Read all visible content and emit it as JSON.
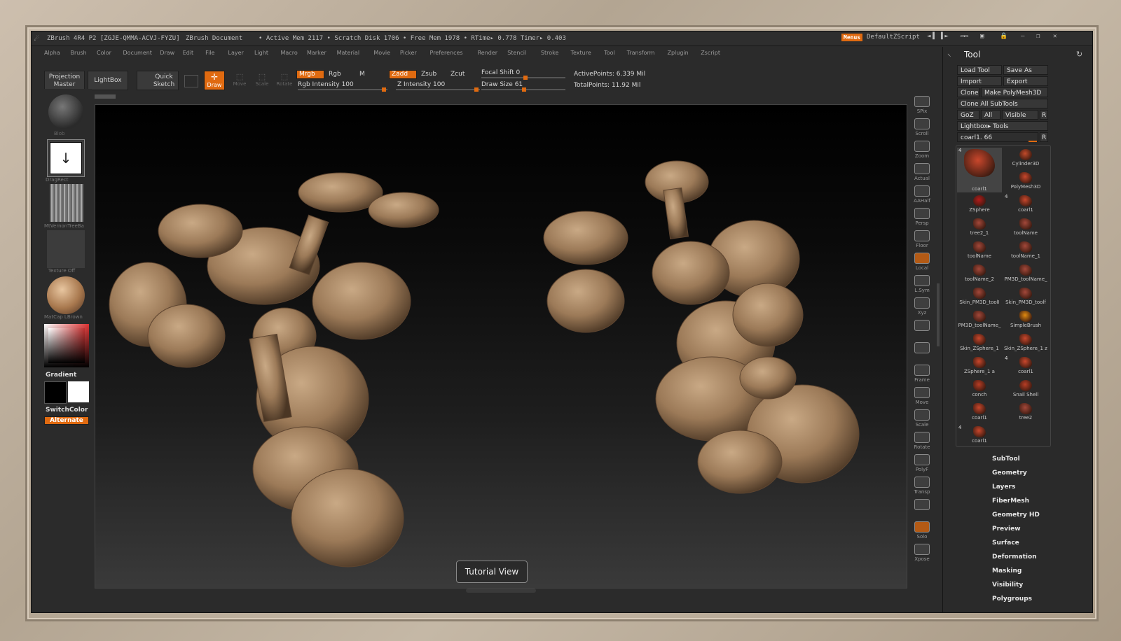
{
  "titlebar": {
    "app": "ZBrush 4R4 P2 [ZGJE-QMMA-ACVJ-FYZU]",
    "document": "ZBrush Document",
    "stats": "• Active Mem 2117 • Scratch Disk 1706 • Free Mem 1978 • RTime▸ 0.778 Timer▸ 0.403",
    "menus_btn": "Menus",
    "script": "DefaultZScript"
  },
  "menu": [
    "Alpha",
    "Brush",
    "Color",
    "Document",
    "Draw",
    "Edit",
    "File",
    "Layer",
    "Light",
    "Macro",
    "Marker",
    "Material",
    "Movie",
    "Picker",
    "Preferences",
    "Render",
    "Stencil",
    "Stroke",
    "Texture",
    "Tool",
    "Transform",
    "Zplugin",
    "Zscript"
  ],
  "toolbar": {
    "projection_master": "Projection Master",
    "lightbox": "LightBox",
    "quick_sketch": "Quick Sketch",
    "edit": "Edit",
    "draw": "Draw",
    "move": "Move",
    "scale": "Scale",
    "rotate": "Rotate",
    "mrgb": "Mrgb",
    "rgb": "Rgb",
    "m": "M",
    "rgb_intensity": "Rgb Intensity 100",
    "zadd": "Zadd",
    "zsub": "Zsub",
    "zcut": "Zcut",
    "z_intensity": "Z Intensity 100",
    "focal_shift": "Focal Shift 0",
    "draw_size": "Draw Size 61",
    "active_points": "ActivePoints: 6.339 Mil",
    "total_points": "TotalPoints: 11.92 Mil"
  },
  "left": {
    "brush_label": "Blob",
    "stroke_label": "DragRect",
    "alpha_label": "MtVernonTreeBa",
    "texture_label": "Texture Off",
    "material_label": "MatCap LBrown",
    "gradient": "Gradient",
    "switch_color": "SwitchColor",
    "alternate": "Alternate"
  },
  "right_shelf": [
    "SPix",
    "Scroll",
    "Zoom",
    "Actual",
    "AAHalf",
    "Persp",
    "Floor",
    "Local",
    "L.Sym",
    "Xyz",
    "",
    "",
    "Frame",
    "Move",
    "Scale",
    "Rotate",
    "PolyF",
    "Transp",
    "",
    "Solo",
    "Xpose"
  ],
  "viewport": {
    "tutorial": "Tutorial View"
  },
  "tray": {
    "title": "Tool",
    "load_tool": "Load Tool",
    "save_as": "Save As",
    "import": "Import",
    "export": "Export",
    "clone": "Clone",
    "make_polymesh": "Make PolyMesh3D",
    "clone_all": "Clone All SubTools",
    "goz": "GoZ",
    "all": "All",
    "visible": "Visible",
    "r": "R",
    "lightbox_tools": "Lightbox▸ Tools",
    "current_tool": "coarl1. 66",
    "tools": [
      {
        "name": "coarl1",
        "badge": "4",
        "color": "#c9472c"
      },
      {
        "name": "Cylinder3D",
        "badge": "",
        "color": "#c24a2a"
      },
      {
        "name": "",
        "badge": "",
        "color": ""
      },
      {
        "name": "PolyMesh3D",
        "badge": "",
        "color": "#c9472c"
      },
      {
        "name": "ZSphere",
        "badge": "",
        "color": "#b31b1b"
      },
      {
        "name": "coarl1",
        "badge": "4",
        "color": "#c9472c"
      },
      {
        "name": "tree2_1",
        "badge": "",
        "color": "#a3483a"
      },
      {
        "name": "toolName",
        "badge": "",
        "color": "#a3483a"
      },
      {
        "name": "toolName",
        "badge": "",
        "color": "#a3483a"
      },
      {
        "name": "toolName_1",
        "badge": "",
        "color": "#a3483a"
      },
      {
        "name": "toolName_2",
        "badge": "",
        "color": "#a3483a"
      },
      {
        "name": "PM3D_toolName_",
        "badge": "",
        "color": "#a3483a"
      },
      {
        "name": "Skin_PM3D_toolI",
        "badge": "",
        "color": "#a3483a"
      },
      {
        "name": "Skin_PM3D_toolf",
        "badge": "",
        "color": "#a3483a"
      },
      {
        "name": "PM3D_toolName_",
        "badge": "",
        "color": "#a3483a"
      },
      {
        "name": "SimpleBrush",
        "badge": "",
        "color": "#e08a10"
      },
      {
        "name": "Skin_ZSphere_1",
        "badge": "",
        "color": "#c9472c"
      },
      {
        "name": "Skin_ZSphere_1 z",
        "badge": "",
        "color": "#c9472c"
      },
      {
        "name": "ZSphere_1 a",
        "badge": "",
        "color": "#c9472c"
      },
      {
        "name": "coarl1",
        "badge": "4",
        "color": "#c9472c"
      },
      {
        "name": "conch",
        "badge": "",
        "color": "#b83d25"
      },
      {
        "name": "Snail Shell",
        "badge": "",
        "color": "#b83d25"
      },
      {
        "name": "coarl1",
        "badge": "",
        "color": "#c9472c"
      },
      {
        "name": "tree2",
        "badge": "",
        "color": "#a3483a"
      },
      {
        "name": "coarl1",
        "badge": "4",
        "color": "#c9472c"
      }
    ],
    "sections": [
      "SubTool",
      "Geometry",
      "Layers",
      "FiberMesh",
      "Geometry HD",
      "Preview",
      "Surface",
      "Deformation",
      "Masking",
      "Visibility",
      "Polygroups"
    ]
  }
}
